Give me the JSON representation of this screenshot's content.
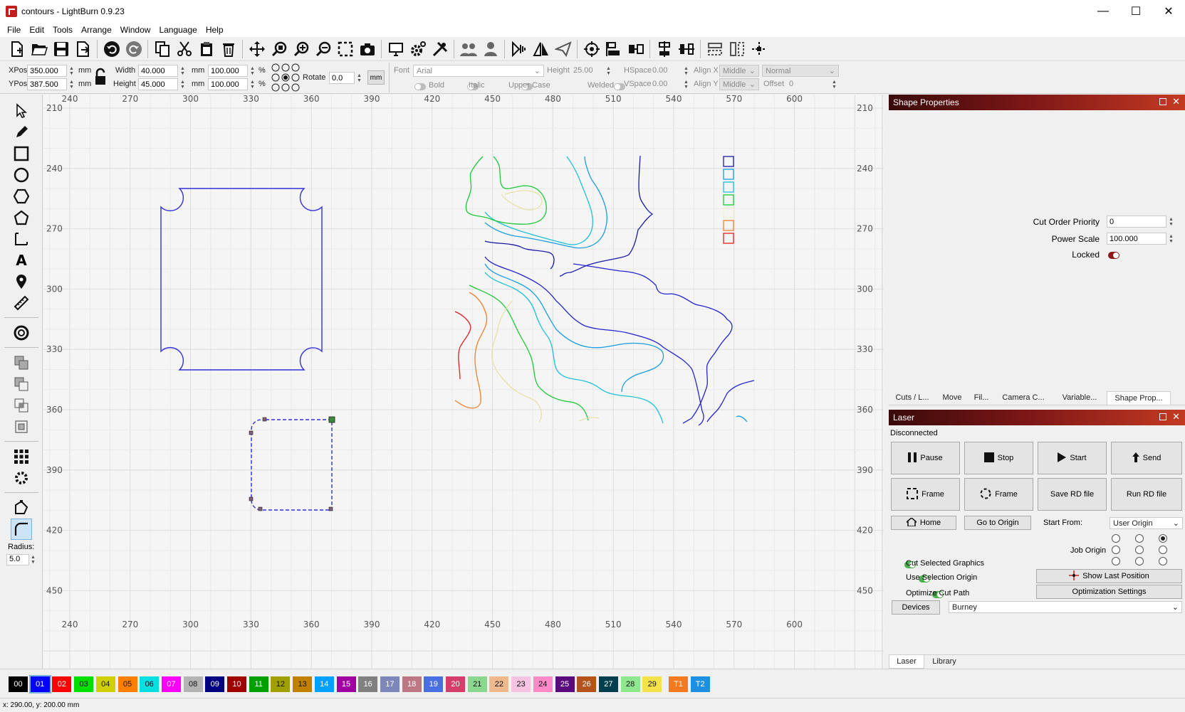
{
  "window": {
    "title": "contours - LightBurn 0.9.23",
    "minimize": "—",
    "maximize": "☐",
    "close": "✕"
  },
  "menu": [
    "File",
    "Edit",
    "Tools",
    "Arrange",
    "Window",
    "Language",
    "Help"
  ],
  "toolbar_icons": [
    "new-file-icon",
    "open-folder-icon",
    "save-icon",
    "export-icon",
    "undo-icon",
    "redo-icon",
    "copy-icon",
    "cut-icon",
    "paste-icon",
    "delete-icon",
    "move-icon",
    "zoom-selection-icon",
    "zoom-in-icon",
    "zoom-out-icon",
    "frame-selection-icon",
    "camera-icon",
    "monitor-icon",
    "settings-gear-icon",
    "device-tools-icon",
    "group-icon",
    "ungroup-icon",
    "flip-horizontal-icon",
    "mirror-icon",
    "send-icon",
    "target-icon",
    "align-left-icon",
    "align-center-icon",
    "distribute-v-icon",
    "distribute-h-icon",
    "align-top-icon",
    "align-mid-icon",
    "dock-center-icon"
  ],
  "props": {
    "xpos_label": "XPos",
    "xpos": "350.000",
    "ypos_label": "YPos",
    "ypos": "387.500",
    "unit": "mm",
    "width_label": "Width",
    "width": "40.000",
    "height_label": "Height",
    "height": "45.000",
    "width_pct": "100.000",
    "height_pct": "100.000",
    "pct": "%",
    "rotate_label": "Rotate",
    "rotate": "0.0",
    "mm_button": "mm",
    "font_label": "Font",
    "font": "Arial",
    "font_height_label": "Height",
    "font_height": "25.00",
    "hspace_label": "HSpace",
    "hspace": "0.00",
    "vspace_label": "VSpace",
    "vspace": "0.00",
    "alignx_label": "Align X",
    "alignx": "Middle",
    "aligny_label": "Align Y",
    "aligny": "Middle",
    "style": "Normal",
    "offset_label": "Offset",
    "offset": "0",
    "bold": "Bold",
    "italic": "Italic",
    "upper_case": "Upper Case",
    "welded": "Welded"
  },
  "left_tools": [
    "select-arrow-icon",
    "pencil-icon",
    "rectangle-icon",
    "ellipse-icon",
    "polygon-icon",
    "pentagon-icon",
    "position-icon",
    "text-icon",
    "pin-icon",
    "ruler-icon",
    "offset-ring-icon",
    "boolean-union-icon",
    "boolean-subtract-icon",
    "boolean-intersect-icon",
    "weld-icon",
    "grid-array-icon",
    "circular-array-icon",
    "edit-nodes-icon",
    "corner-radius-icon"
  ],
  "radius": {
    "label": "Radius:",
    "value": "5.0"
  },
  "ruler": {
    "top": [
      "240",
      "270",
      "300",
      "330",
      "360",
      "390",
      "420",
      "450",
      "480",
      "510",
      "540",
      "570",
      "600"
    ],
    "left": [
      "210",
      "240",
      "270",
      "300",
      "330",
      "360",
      "390",
      "420",
      "450"
    ]
  },
  "shape_properties": {
    "title": "Shape Properties",
    "cut_order_label": "Cut Order Priority",
    "cut_order": "0",
    "power_scale_label": "Power Scale",
    "power_scale": "100.000",
    "locked_label": "Locked"
  },
  "panel_tabs": [
    "Cuts / L...",
    "Move",
    "Fil...",
    "Camera C...",
    "Variable...",
    "Shape Prop..."
  ],
  "laser": {
    "title": "Laser",
    "status": "Disconnected",
    "pause": "Pause",
    "stop": "Stop",
    "start": "Start",
    "send": "Send",
    "frame1": "Frame",
    "frame2": "Frame",
    "save_rd": "Save RD file",
    "run_rd": "Run RD file",
    "home": "Home",
    "go_origin": "Go to Origin",
    "start_from_label": "Start From:",
    "start_from": "User Origin",
    "job_origin_label": "Job Origin",
    "cut_selected": "Cut Selected Graphics",
    "use_selection_origin": "Use Selection Origin",
    "optimize_cut": "Optimize Cut Path",
    "show_last": "Show Last Position",
    "opt_settings": "Optimization Settings",
    "devices": "Devices",
    "device": "Burney"
  },
  "bottom_tabs": [
    "Laser",
    "Library"
  ],
  "palette": [
    {
      "label": "00",
      "color": "#000000"
    },
    {
      "label": "01",
      "color": "#0000ff"
    },
    {
      "label": "02",
      "color": "#ff0000"
    },
    {
      "label": "03",
      "color": "#00e000"
    },
    {
      "label": "04",
      "color": "#d0d000"
    },
    {
      "label": "05",
      "color": "#ff8000"
    },
    {
      "label": "06",
      "color": "#00e0e0"
    },
    {
      "label": "07",
      "color": "#ff00ff"
    },
    {
      "label": "08",
      "color": "#b4b4b4"
    },
    {
      "label": "09",
      "color": "#000080"
    },
    {
      "label": "10",
      "color": "#a00000"
    },
    {
      "label": "11",
      "color": "#00a000"
    },
    {
      "label": "12",
      "color": "#a0a000"
    },
    {
      "label": "13",
      "color": "#c08000"
    },
    {
      "label": "14",
      "color": "#00a0ff"
    },
    {
      "label": "15",
      "color": "#a000a0"
    },
    {
      "label": "16",
      "color": "#808080"
    },
    {
      "label": "17",
      "color": "#7d87b9"
    },
    {
      "label": "18",
      "color": "#bb7784"
    },
    {
      "label": "19",
      "color": "#4a6fe3"
    },
    {
      "label": "20",
      "color": "#d33f6a"
    },
    {
      "label": "21",
      "color": "#8cd78f"
    },
    {
      "label": "22",
      "color": "#f0b98d"
    },
    {
      "label": "23",
      "color": "#f6c4e1"
    },
    {
      "label": "24",
      "color": "#fe89c9"
    },
    {
      "label": "25",
      "color": "#5a0a7a"
    },
    {
      "label": "26",
      "color": "#b4531a"
    },
    {
      "label": "27",
      "color": "#023f4e"
    },
    {
      "label": "28",
      "color": "#8fe88f"
    },
    {
      "label": "29",
      "color": "#f4e24a"
    },
    {
      "label": "T1",
      "color": "#f47a21"
    },
    {
      "label": "T2",
      "color": "#1e90e0"
    }
  ],
  "status_text": "x: 290.00, y: 200.00 mm"
}
